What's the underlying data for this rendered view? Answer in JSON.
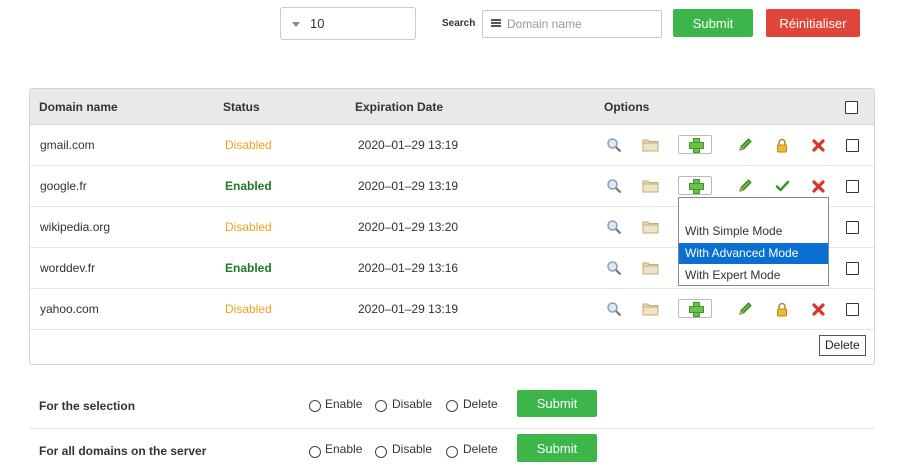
{
  "toolbar": {
    "per_page_value": "10",
    "search_label": "Search",
    "search_placeholder": "Domain name",
    "submit_label": "Submit",
    "reset_label": "Réinitialiser"
  },
  "table": {
    "headers": [
      "Domain name",
      "Status",
      "Expiration Date",
      "Options"
    ],
    "rows": [
      {
        "domain": "gmail.com",
        "status": "Disabled",
        "expiration": "2020–01–29 13:19"
      },
      {
        "domain": "google.fr",
        "status": "Enabled",
        "expiration": "2020–01–29 13:19"
      },
      {
        "domain": "wikipedia.org",
        "status": "Disabled",
        "expiration": "2020–01–29 13:20"
      },
      {
        "domain": "worddev.fr",
        "status": "Enabled",
        "expiration": "2020–01–29 13:16"
      },
      {
        "domain": "yahoo.com",
        "status": "Disabled",
        "expiration": "2020–01–29 13:19"
      }
    ]
  },
  "dropdown": {
    "items": [
      "With Simple Mode",
      "With Advanced Mode",
      "With Expert Mode"
    ],
    "selected": "With Advanced Mode"
  },
  "tooltip": "Delete",
  "bulk": {
    "selection_label": "For the selection",
    "server_label": "For all domains on the server",
    "options": [
      "Enable",
      "Disable",
      "Delete"
    ],
    "submit_label": "Submit"
  },
  "colors": {
    "green": "#3cb54a",
    "red": "#e0453a",
    "disabled": "#f0a020",
    "enabled": "#1e7a1e",
    "highlight": "#0a6fd0"
  }
}
